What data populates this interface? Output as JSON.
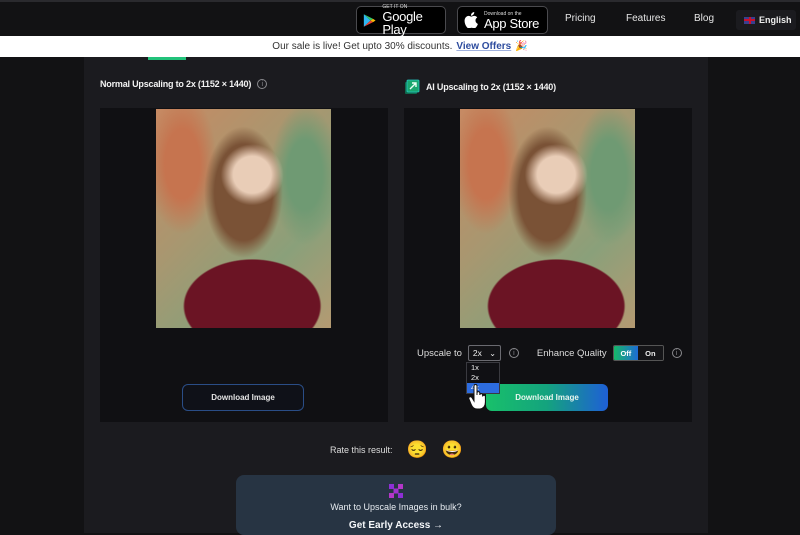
{
  "header": {
    "google_play": {
      "small": "GET IT ON",
      "big": "Google Play"
    },
    "app_store": {
      "small": "Download on the",
      "big": "App Store"
    },
    "nav": [
      "Pricing",
      "Features",
      "Blog"
    ],
    "language": "English"
  },
  "banner": {
    "text": "Our sale is live! Get upto 30% discounts.",
    "link": "View Offers",
    "emoji": "🎉"
  },
  "left_panel": {
    "title": "Normal Upscaling to 2x (1152 × 1440)",
    "download_label": "Download Image"
  },
  "right_panel": {
    "title": "AI Upscaling to 2x (1152 × 1440)",
    "upscale_label": "Upscale to",
    "upscale_value": "2x",
    "upscale_options": [
      "1x",
      "2x",
      "4x"
    ],
    "highlighted_option": "4x",
    "enhance_label": "Enhance Quality",
    "toggle_off": "Off",
    "toggle_on": "On",
    "toggle_state": "Off",
    "download_label": "Download Image"
  },
  "rating": {
    "label": "Rate this result:",
    "bad": "😔",
    "good": "😀"
  },
  "bulk": {
    "text": "Want to Upscale Images in bulk?",
    "link": "Get Early Access →"
  },
  "colors": {
    "accent_green": "#18c06a",
    "accent_blue": "#1e5fd6",
    "banner_link": "#2d4c9e"
  }
}
